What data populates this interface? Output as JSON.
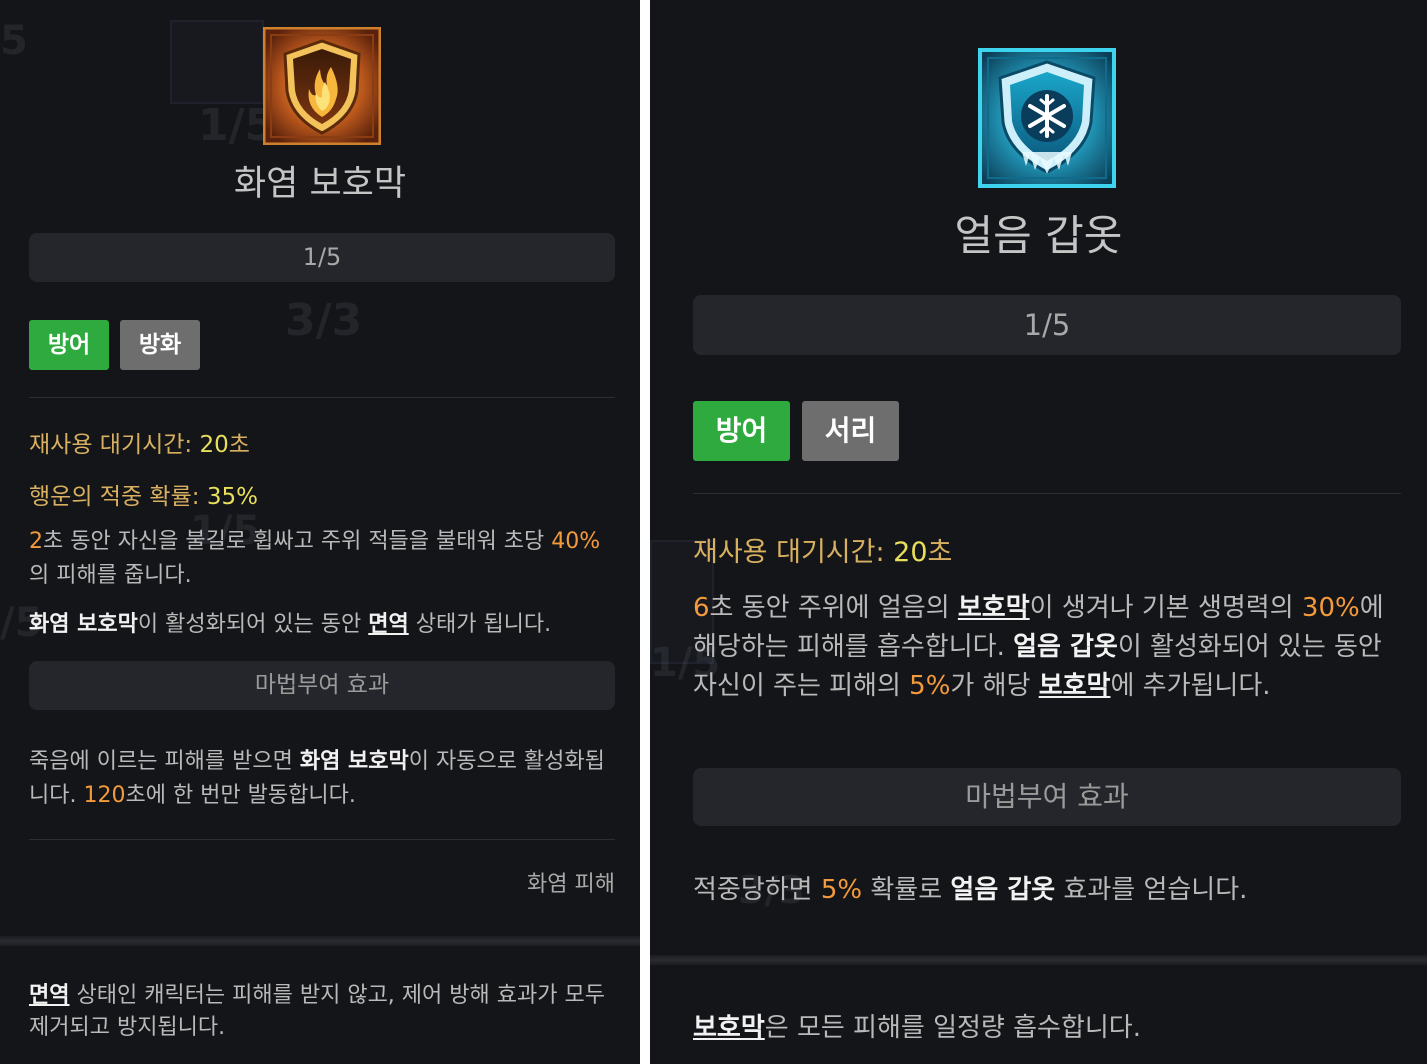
{
  "left": {
    "skill_name": "화염 보호막",
    "level": "1/5",
    "tags": [
      "방어",
      "방화"
    ],
    "cooldown": {
      "label": "재사용 대기시간: ",
      "value": "20",
      "unit": "초"
    },
    "crit": {
      "label": "행운의 적중 확률: ",
      "value": "35%"
    },
    "desc1": {
      "n1": "2",
      "t1": "초 동안 자신을 불길로 휩싸고 주위 적들을 불태워 초당 ",
      "n2": "40%",
      "t2": "의 피해를 줍니다."
    },
    "desc2": {
      "k1": "화염 보호막",
      "t1": "이 활성화되어 있는 동안 ",
      "k2": "면역",
      "t2": " 상태가 됩니다."
    },
    "enchant_header": "마법부여 효과",
    "enchant": {
      "t1": "죽음에 이르는 피해를 받으면 ",
      "k1": "화염 보호막",
      "t2": "이 자동으로 활성화됩니다. ",
      "n1": "120",
      "t3": "초에 한 번만 발동합니다."
    },
    "damage_type": "화염 피해",
    "footer": {
      "k1": "면역",
      "t1": " 상태인 캐릭터는 피해를 받지 않고, 제어 방해 효과가 모두 제거되고 방지됩니다."
    },
    "ghost_texts": [
      "5",
      "1/5",
      "3/3",
      "1/5",
      "/5"
    ]
  },
  "right": {
    "skill_name": "얼음 갑옷",
    "level": "1/5",
    "tags": [
      "방어",
      "서리"
    ],
    "cooldown": {
      "label": "재사용 대기시간: ",
      "value": "20",
      "unit": "초"
    },
    "desc1": {
      "n1": "6",
      "t1": "초 동안 주위에 얼음의 ",
      "k1": "보호막",
      "t2": "이 생겨나 기본 생명력의 ",
      "n2": "30%",
      "t3": "에 해당하는 피해를 흡수합니다. ",
      "k2": "얼음 갑옷",
      "t4": "이 활성화되어 있는 동안 자신이 주는 피해의 ",
      "n3": "5%",
      "t5": "가 해당 ",
      "k3": "보호막",
      "t6": "에 추가됩니다."
    },
    "enchant_header": "마법부여 효과",
    "enchant": {
      "t1": "적중당하면 ",
      "n1": "5%",
      "t2": " 확률로 ",
      "k1": "얼음 갑옷",
      "t3": " 효과를 얻습니다."
    },
    "footer": {
      "k1": "보호막",
      "t1": "은 모든 피해를 일정량 흡수합니다."
    },
    "ghost_texts": [
      "1/5",
      "3/3"
    ]
  },
  "colors": {
    "background": "#141518",
    "tag_green": "#2eaa3f",
    "tag_gray": "#6e6e6e",
    "stat_label": "#d8b060",
    "stat_value": "#e8df5c",
    "number": "#f39a3c"
  },
  "icons": {
    "left": "fire-shield-icon",
    "right": "ice-shield-icon"
  }
}
